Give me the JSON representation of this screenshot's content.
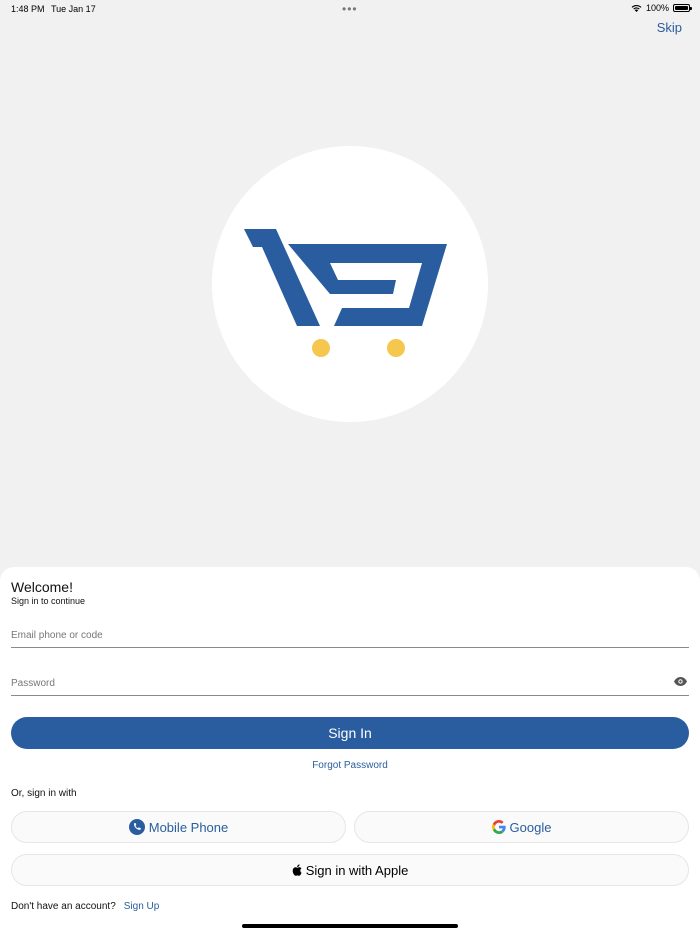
{
  "status_bar": {
    "time": "1:48 PM",
    "date": "Tue Jan 17",
    "dots": "•••",
    "battery": "100%"
  },
  "header": {
    "skip_label": "Skip"
  },
  "logo": {
    "icon": "shopping-cart-logo",
    "colors": {
      "cart": "#2a5d9f",
      "wheels": "#f5c74e"
    }
  },
  "welcome": {
    "title": "Welcome!",
    "subtitle": "Sign in to continue"
  },
  "form": {
    "email_placeholder": "Email phone or code",
    "email_value": "",
    "password_placeholder": "Password",
    "password_value": "",
    "signin_label": "Sign In",
    "forgot_label": "Forgot Password"
  },
  "social": {
    "or_label": "Or, sign in with",
    "mobile_label": "Mobile Phone",
    "google_label": "Google",
    "apple_label": "Sign in with Apple"
  },
  "footer": {
    "no_account_label": "Don't have an account?",
    "signup_label": "Sign Up"
  },
  "colors": {
    "accent": "#2a5d9f",
    "background": "#f1f1f1"
  }
}
